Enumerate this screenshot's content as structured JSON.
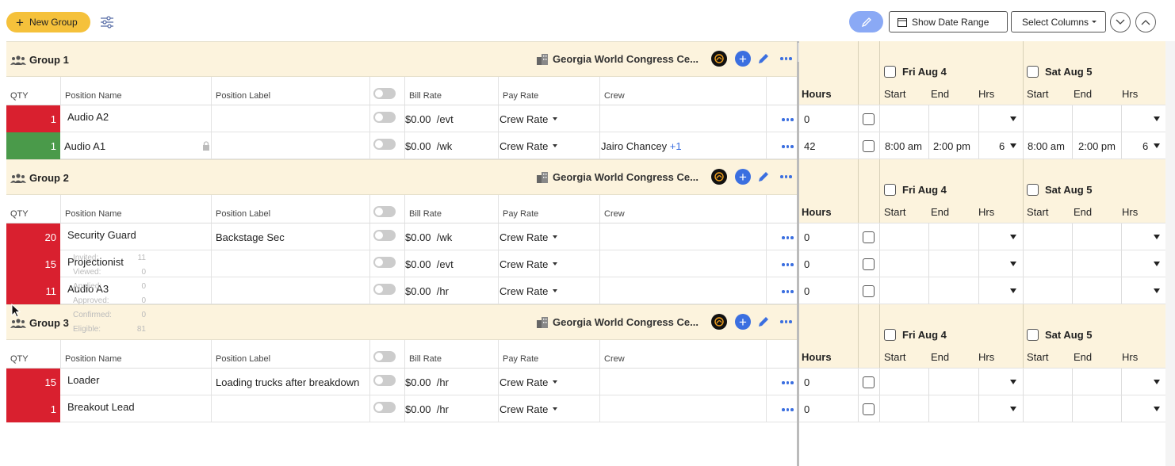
{
  "toolbar": {
    "new_group_label": "New Group",
    "show_date_range_label": "Show Date Range",
    "select_columns_label": "Select Columns",
    "icons": [
      "plus-icon",
      "filter-sliders-icon",
      "pencil-icon",
      "calendar-icon",
      "chevron-down-icon",
      "chevron-up-icon"
    ]
  },
  "columns": {
    "qty": "QTY",
    "position_name": "Position Name",
    "position_label": "Position Label",
    "bill_rate": "Bill Rate",
    "pay_rate": "Pay Rate",
    "crew": "Crew"
  },
  "right_columns": {
    "hours": "Hours",
    "days": [
      "Fri Aug 4",
      "Sat Aug 5"
    ],
    "start": "Start",
    "end": "End",
    "hrs": "Hrs"
  },
  "groups": [
    {
      "title": "Group 1",
      "venue": "Georgia World Congress Ce...",
      "rows": [
        {
          "qty": "1",
          "qty_color": "#d9202f",
          "name": "Audio A2",
          "label": "",
          "bill_amount": "$0.00",
          "bill_unit": "/evt",
          "pay_rate": "Crew Rate",
          "crew": "",
          "crew_more": "",
          "hours": "0",
          "fri_start": "",
          "fri_end": "",
          "fri_hrs": "",
          "sat_start": "",
          "sat_end": "",
          "sat_hrs": ""
        },
        {
          "qty": "1",
          "qty_color": "#4a9a4a",
          "name": "Audio A1",
          "label": "",
          "bill_amount": "$0.00",
          "bill_unit": "/wk",
          "pay_rate": "Crew Rate",
          "crew": "Jairo Chancey",
          "crew_more": "+1",
          "hours": "42",
          "fri_start": "8:00 am",
          "fri_end": "2:00 pm",
          "fri_hrs": "6",
          "sat_start": "8:00 am",
          "sat_end": "2:00 pm",
          "sat_hrs": "6"
        }
      ]
    },
    {
      "title": "Group 2",
      "venue": "Georgia World Congress Ce...",
      "rows": [
        {
          "qty": "20",
          "qty_color": "#d9202f",
          "name": "Security Guard",
          "label": "Backstage Sec",
          "bill_amount": "$0.00",
          "bill_unit": "/wk",
          "pay_rate": "Crew Rate",
          "crew": "",
          "crew_more": "",
          "hours": "0",
          "fri_start": "",
          "fri_end": "",
          "fri_hrs": "",
          "sat_start": "",
          "sat_end": "",
          "sat_hrs": ""
        },
        {
          "qty": "15",
          "qty_color": "#d9202f",
          "name": "Projectionist",
          "label": "",
          "bill_amount": "$0.00",
          "bill_unit": "/evt",
          "pay_rate": "Crew Rate",
          "crew": "",
          "crew_more": "",
          "hours": "0",
          "fri_start": "",
          "fri_end": "",
          "fri_hrs": "",
          "sat_start": "",
          "sat_end": "",
          "sat_hrs": ""
        },
        {
          "qty": "11",
          "qty_color": "#d9202f",
          "name": "Audio A3",
          "label": "",
          "bill_amount": "$0.00",
          "bill_unit": "/hr",
          "pay_rate": "Crew Rate",
          "crew": "",
          "crew_more": "",
          "hours": "0",
          "fri_start": "",
          "fri_end": "",
          "fri_hrs": "",
          "sat_start": "",
          "sat_end": "",
          "sat_hrs": ""
        }
      ]
    },
    {
      "title": "Group 3",
      "venue": "Georgia World Congress Ce...",
      "rows": [
        {
          "qty": "15",
          "qty_color": "#d9202f",
          "name": "Loader",
          "label": "Loading trucks after breakdown",
          "bill_amount": "$0.00",
          "bill_unit": "/hr",
          "pay_rate": "Crew Rate",
          "crew": "",
          "crew_more": "",
          "hours": "0",
          "fri_start": "",
          "fri_end": "",
          "fri_hrs": "",
          "sat_start": "",
          "sat_end": "",
          "sat_hrs": ""
        },
        {
          "qty": "1",
          "qty_color": "#d9202f",
          "name": "Breakout Lead",
          "label": "",
          "bill_amount": "$0.00",
          "bill_unit": "/hr",
          "pay_rate": "Crew Rate",
          "crew": "",
          "crew_more": "",
          "hours": "0",
          "fri_start": "",
          "fri_end": "",
          "fri_hrs": "",
          "sat_start": "",
          "sat_end": "",
          "sat_hrs": ""
        }
      ]
    }
  ],
  "tooltip": {
    "lines": [
      {
        "label": "Invited:",
        "value": "11"
      },
      {
        "label": "Viewed:",
        "value": "0"
      },
      {
        "label": "Applied:",
        "value": "0"
      },
      {
        "label": "Approved:",
        "value": "0"
      },
      {
        "label": "Confirmed:",
        "value": "0"
      },
      {
        "label": "Eligible:",
        "value": "81"
      }
    ]
  },
  "colors": {
    "accent_yellow": "#f5c13b",
    "group_bg": "#fcf3dd",
    "qty_red": "#d9202f",
    "qty_green": "#4a9a4a",
    "action_blue": "#3b6fe0"
  }
}
